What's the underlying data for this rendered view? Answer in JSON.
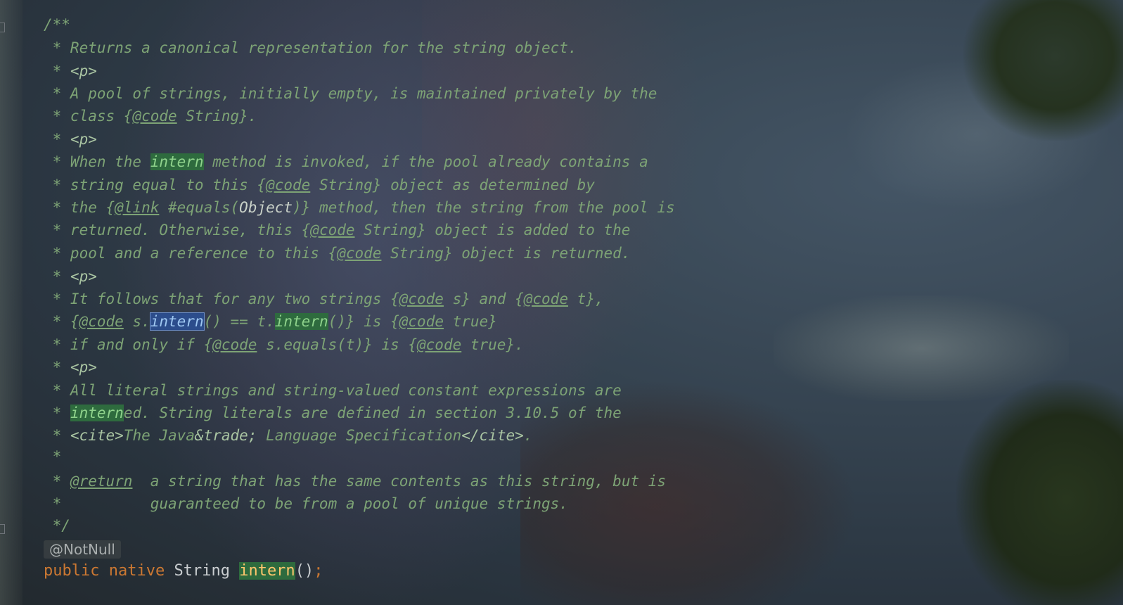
{
  "doc_lines": {
    "l0": "/**",
    "l1": " * Returns a canonical representation for the string object.",
    "l2a": " * ",
    "l2b": "<p>",
    "l3": " * A pool of strings, initially empty, is maintained privately by the",
    "l4a": " * class {",
    "l4b": "@code",
    "l4c": " String}.",
    "l5a": " * ",
    "l5b": "<p>",
    "l6a": " * When the ",
    "l6b": "intern",
    "l6c": " method is invoked, if the pool already contains a",
    "l7a": " * string equal to this {",
    "l7b": "@code",
    "l7c": " String} object as determined by",
    "l8a": " * the {",
    "l8b": "@link",
    "l8c": " #equals(",
    "l8d": "Object",
    "l8e": ")} method, then the string from the pool is",
    "l9a": " * returned. Otherwise, this {",
    "l9b": "@code",
    "l9c": " String} object is added to the",
    "l10a": " * pool and a reference to this {",
    "l10b": "@code",
    "l10c": " String} object is returned.",
    "l11a": " * ",
    "l11b": "<p>",
    "l12a": " * It follows that for any two strings {",
    "l12b": "@code",
    "l12c": " s} and {",
    "l12d": "@code",
    "l12e": " t},",
    "l13a": " * {",
    "l13b": "@code",
    "l13c": " s.",
    "l13d": "intern",
    "l13e": "() == t.",
    "l13f": "intern",
    "l13g": "()} is {",
    "l13h": "@code",
    "l13i": " true}",
    "l14a": " * if and only if {",
    "l14b": "@code",
    "l14c": " s.equals(t)} is {",
    "l14d": "@code",
    "l14e": " true}.",
    "l15a": " * ",
    "l15b": "<p>",
    "l16": " * All literal strings and string-valued constant expressions are",
    "l17a": " * ",
    "l17b": "intern",
    "l17c": "ed. String literals are defined in section 3.10.5 of the",
    "l18a": " * ",
    "l18b": "<cite>",
    "l18c": "The Java",
    "l18d": "&trade;",
    "l18e": " Language Specification",
    "l18f": "</cite>",
    "l18g": ".",
    "l19": " *",
    "l20a": " * ",
    "l20b": "@return",
    "l20c": "  a string that has the same contents as this string, but is",
    "l21": " *          guaranteed to be from a pool of unique strings.",
    "l22": " */"
  },
  "annotation": "@NotNull",
  "code": {
    "kw_public": "public",
    "kw_native": "native",
    "type": "String",
    "method": "intern",
    "parens": "()",
    "semicolon": ";"
  },
  "colors": {
    "doc_comment": "#7da375",
    "keyword": "#cc7832",
    "highlight_bg": "#2e6b3e",
    "selection_bg": "#2c4d8c"
  }
}
